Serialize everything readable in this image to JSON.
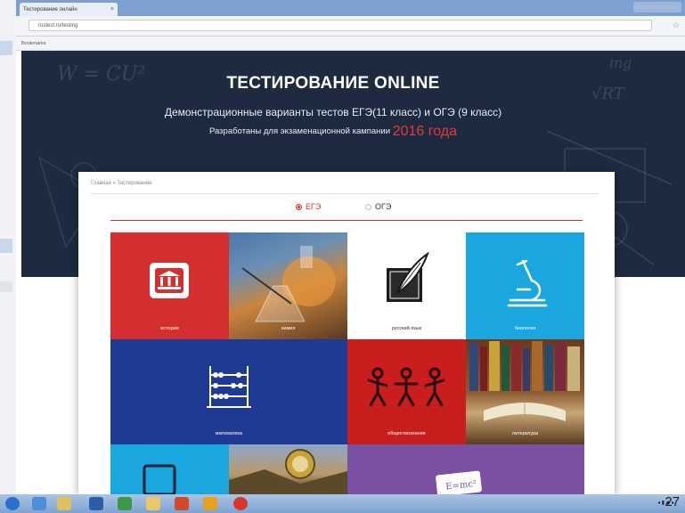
{
  "browser": {
    "tab_title": "Тестирование онлайн",
    "tab_close": "×",
    "address": "rustest.ru/testing",
    "bookmarks_label": "Bookmarks"
  },
  "hero": {
    "title": "ТЕСТИРОВАНИЕ ONLINE",
    "subtitle": "Демонстрационные варианты тестов ЕГЭ(11 класс) и ОГЭ (9 класс)",
    "subtitle2_prefix": "Разработаны для экзаменационной кампании",
    "subtitle2_year": "2016 года",
    "chalk_formulas": [
      "W = CU²",
      "mg",
      "√RT"
    ]
  },
  "card": {
    "breadcrumb": "Главная » Тестирование",
    "exam_options": [
      {
        "label": "ЕГЭ",
        "selected": true
      },
      {
        "label": "ОГЭ",
        "selected": false
      }
    ]
  },
  "tiles": [
    {
      "id": "history",
      "label": "история",
      "color": "#d32f2f",
      "icon": "museum-icon"
    },
    {
      "id": "chemistry",
      "label": "химия",
      "color": "#7a5a3a",
      "icon": "flask-photo"
    },
    {
      "id": "russian",
      "label": "русский язык",
      "color": "#ffffff",
      "icon": "feather-book-icon"
    },
    {
      "id": "biology",
      "label": "биология",
      "color": "#1aa7e0",
      "icon": "microscope-icon"
    },
    {
      "id": "math",
      "label": "математика",
      "color": "#1f3a93",
      "icon": "abacus-icon"
    },
    {
      "id": "social",
      "label": "обществознание",
      "color": "#c81e1e",
      "icon": "people-icon"
    },
    {
      "id": "literature",
      "label": "литература",
      "color": "#8b5a2b",
      "icon": "books-photo"
    },
    {
      "id": "informatics",
      "label": "",
      "color": "#1aa7e0",
      "icon": "tablet-icon"
    },
    {
      "id": "geography",
      "label": "",
      "color": "#6d5a3a",
      "icon": "compass-photo"
    },
    {
      "id": "physics",
      "label": "",
      "color": "#7b4fa2",
      "icon": "formula-icon"
    }
  ],
  "page_number": "27"
}
